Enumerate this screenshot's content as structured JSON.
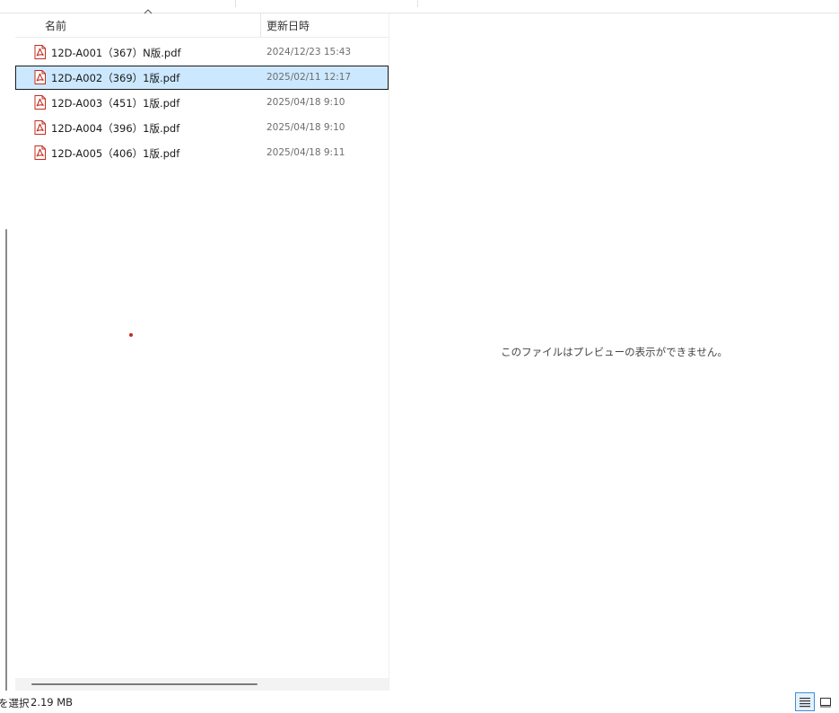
{
  "file_list": {
    "columns": {
      "name": "名前",
      "modified": "更新日時"
    },
    "files": [
      {
        "name": "12D-A001（367）N版.pdf",
        "modified": "2024/12/23 15:43",
        "selected": false
      },
      {
        "name": "12D-A002（369）1版.pdf",
        "modified": "2025/02/11 12:17",
        "selected": true
      },
      {
        "name": "12D-A003（451）1版.pdf",
        "modified": "2025/04/18 9:10",
        "selected": false
      },
      {
        "name": "12D-A004（396）1版.pdf",
        "modified": "2025/04/18 9:10",
        "selected": false
      },
      {
        "name": "12D-A005（406）1版.pdf",
        "modified": "2025/04/18 9:11",
        "selected": false
      }
    ],
    "file_icon": "pdf-file-icon",
    "sort_icon": "sort-ascending-icon"
  },
  "preview": {
    "message": "このファイルはプレビューの表示ができません。"
  },
  "status_bar": {
    "selection_text": "を選択",
    "selection_size": "2.19 MB",
    "view_buttons": [
      "details-view-icon",
      "tiles-view-icon"
    ]
  },
  "colors": {
    "selection_bg": "#cce8ff",
    "pdf_red": "#c42b1c",
    "accent": "#3b8fd6"
  }
}
